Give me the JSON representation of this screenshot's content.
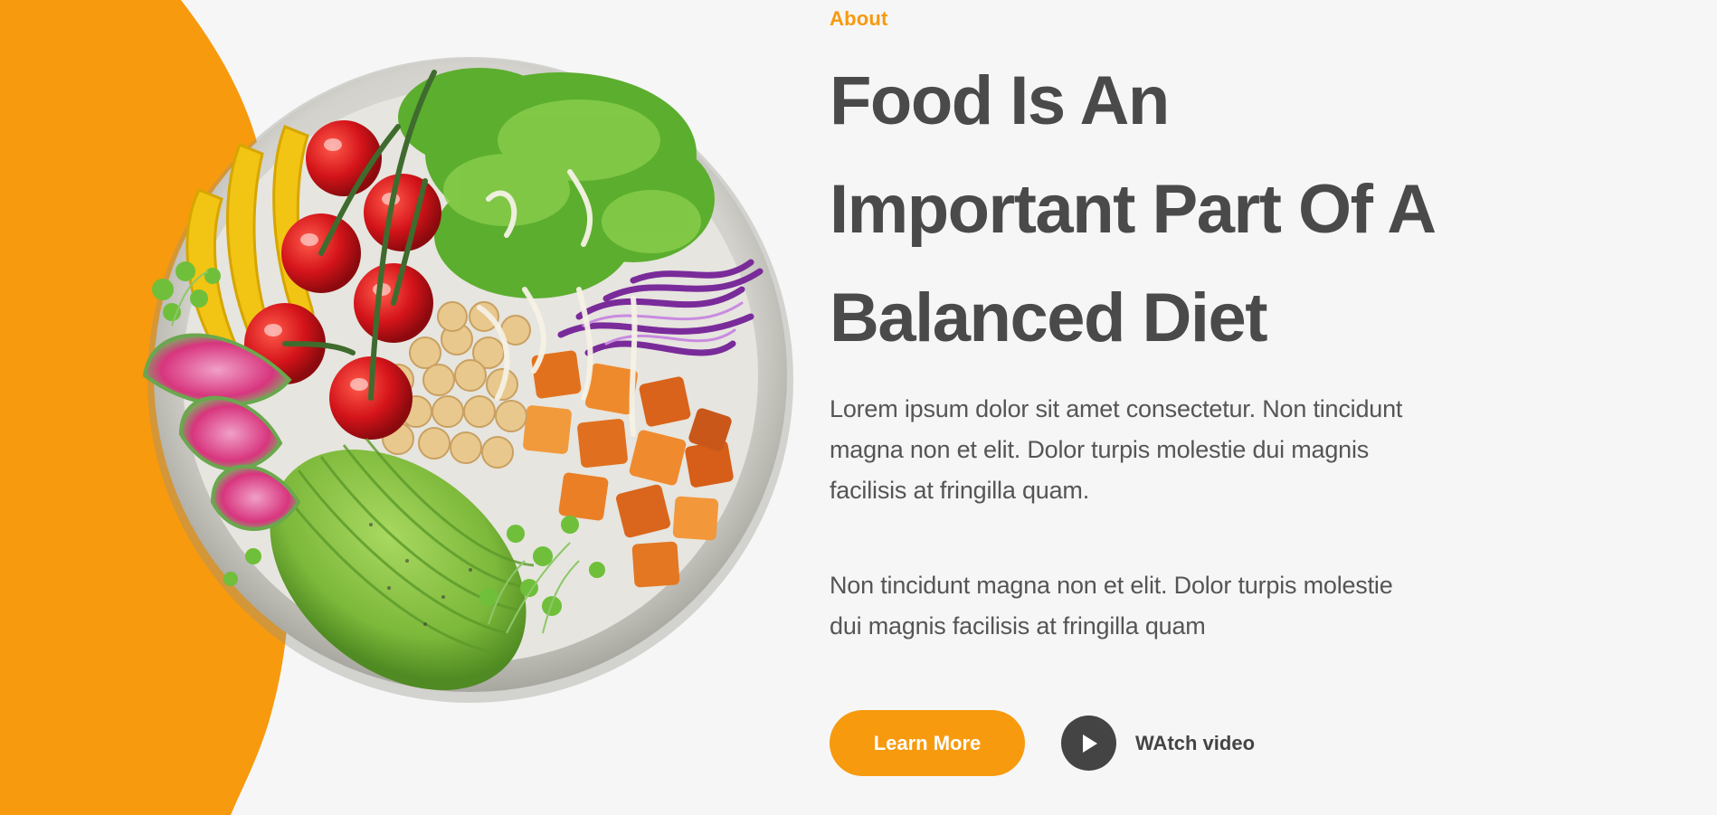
{
  "about": {
    "eyebrow": "About",
    "title_lines": [
      "Food Is An",
      "Important Part Of A",
      "Balanced Diet"
    ],
    "paragraph_1": "Lorem ipsum dolor sit amet consectetur. Non tincidunt magna non et elit. Dolor turpis molestie dui magnis facilisis at fringilla quam.",
    "paragraph_2": "Non tincidunt magna non et elit. Dolor turpis molestie dui magnis facilisis at fringilla quam",
    "learn_more_label": "Learn More",
    "watch_video_label": "WAtch video"
  },
  "icons": {
    "play": "play-icon"
  },
  "colors": {
    "accent": "#F79A0E",
    "heading": "#4a4a4a",
    "body_text": "#555555",
    "background": "#f6f6f6",
    "play_button": "#444444"
  }
}
